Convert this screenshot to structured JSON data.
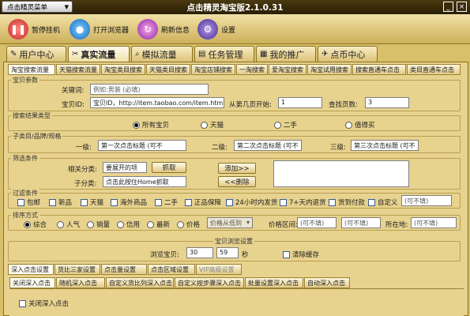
{
  "window": {
    "title": "点击精灵淘宝版2.1.0.31",
    "menu_button": "点击精灵菜单",
    "minimize": "_",
    "close": "×"
  },
  "toolbar": {
    "buttons": [
      {
        "label": "暂停挂机",
        "icon": "pause-icon"
      },
      {
        "label": "打开浏览器",
        "icon": "browser-icon"
      },
      {
        "label": "刷新信息",
        "icon": "refresh-icon"
      },
      {
        "label": "设置",
        "icon": "settings-icon"
      }
    ]
  },
  "main_tabs": [
    "用户中心",
    "真实流量",
    "模拟流量",
    "任务管理",
    "我的推广",
    "点币中心"
  ],
  "sub_tabs": [
    "淘宝搜索流量",
    "天猫搜索流量",
    "淘宝类目搜索",
    "天猫类目搜索",
    "淘宝店铺搜索",
    "一淘搜索",
    "爱淘宝搜索",
    "淘宝试用搜索",
    "搜索直通车点击",
    "类目直通车点击"
  ],
  "product_params": {
    "legend": "宝贝参数",
    "keyword_label": "关键词:",
    "keyword_placeholder": "例如:男装 (必填)",
    "id_label": "宝贝ID:",
    "id_value": "宝贝ID，http://item.taobao.com/item.htm?id=11",
    "page_start_label": "从第几页开始:",
    "page_start_value": "1",
    "pages_label": "查找页数:",
    "pages_value": "3"
  },
  "search_type": {
    "legend": "搜索结果类型",
    "options": [
      "所有宝贝",
      "天猫",
      "二手",
      "值得买"
    ],
    "selected": 0
  },
  "category": {
    "legend": "子类目/品牌/规格",
    "level1_label": "一级:",
    "level1_value": "第一次点击标题 (可不",
    "level2_label": "二级:",
    "level2_value": "第二次点击标题 (可不",
    "level3_label": "三级:",
    "level3_value": "第三次点击标题 (可不"
  },
  "filter": {
    "legend": "筛选条件",
    "related_label": "相关分类:",
    "related_value": "要展开的项",
    "grab_button": "抓取",
    "subcat_label": "子分类:",
    "subcat_value": "点击此按住Home抓取",
    "add_button": "添加>>",
    "delete_button": "<<删除"
  },
  "filter_options": {
    "legend": "过滤条件",
    "items": [
      "包邮",
      "新品",
      "天猫",
      "海外商品",
      "二手",
      "正品保障",
      "24小时内发货",
      "7+天内退货",
      "货到付款",
      "自定义"
    ],
    "custom_placeholder": "(可不填)"
  },
  "sort": {
    "legend": "排序方式",
    "options": [
      "综合",
      "人气",
      "销量",
      "信用",
      "最新",
      "价格"
    ],
    "selected": 0,
    "price_sort_select": "价格从低到",
    "price_range_label": "价格区间:",
    "price_min": "(可不填)",
    "price_max": "(可不填)",
    "location_label": "所在地:",
    "location_value": "(可不填)"
  },
  "browse_settings": {
    "legend": "宝贝浏览设置",
    "browse_label": "浏览宝贝:",
    "min_value": "30",
    "dash": "-",
    "max_value": "59",
    "unit": "秒",
    "clear_cache": "清除缓存"
  },
  "lower_tabs": [
    "深入点击设置",
    "货比三家设置",
    "点击量设置",
    "点击区域设置",
    "VIP高级设置"
  ],
  "deep_tabs": [
    "关闭深入点击",
    "随机深入点击",
    "自定义货比列深入点击",
    "自定义按步骤深入点击",
    "批量设置深入点击",
    "自动深入点击"
  ],
  "deep_option": "关闭深入点击"
}
